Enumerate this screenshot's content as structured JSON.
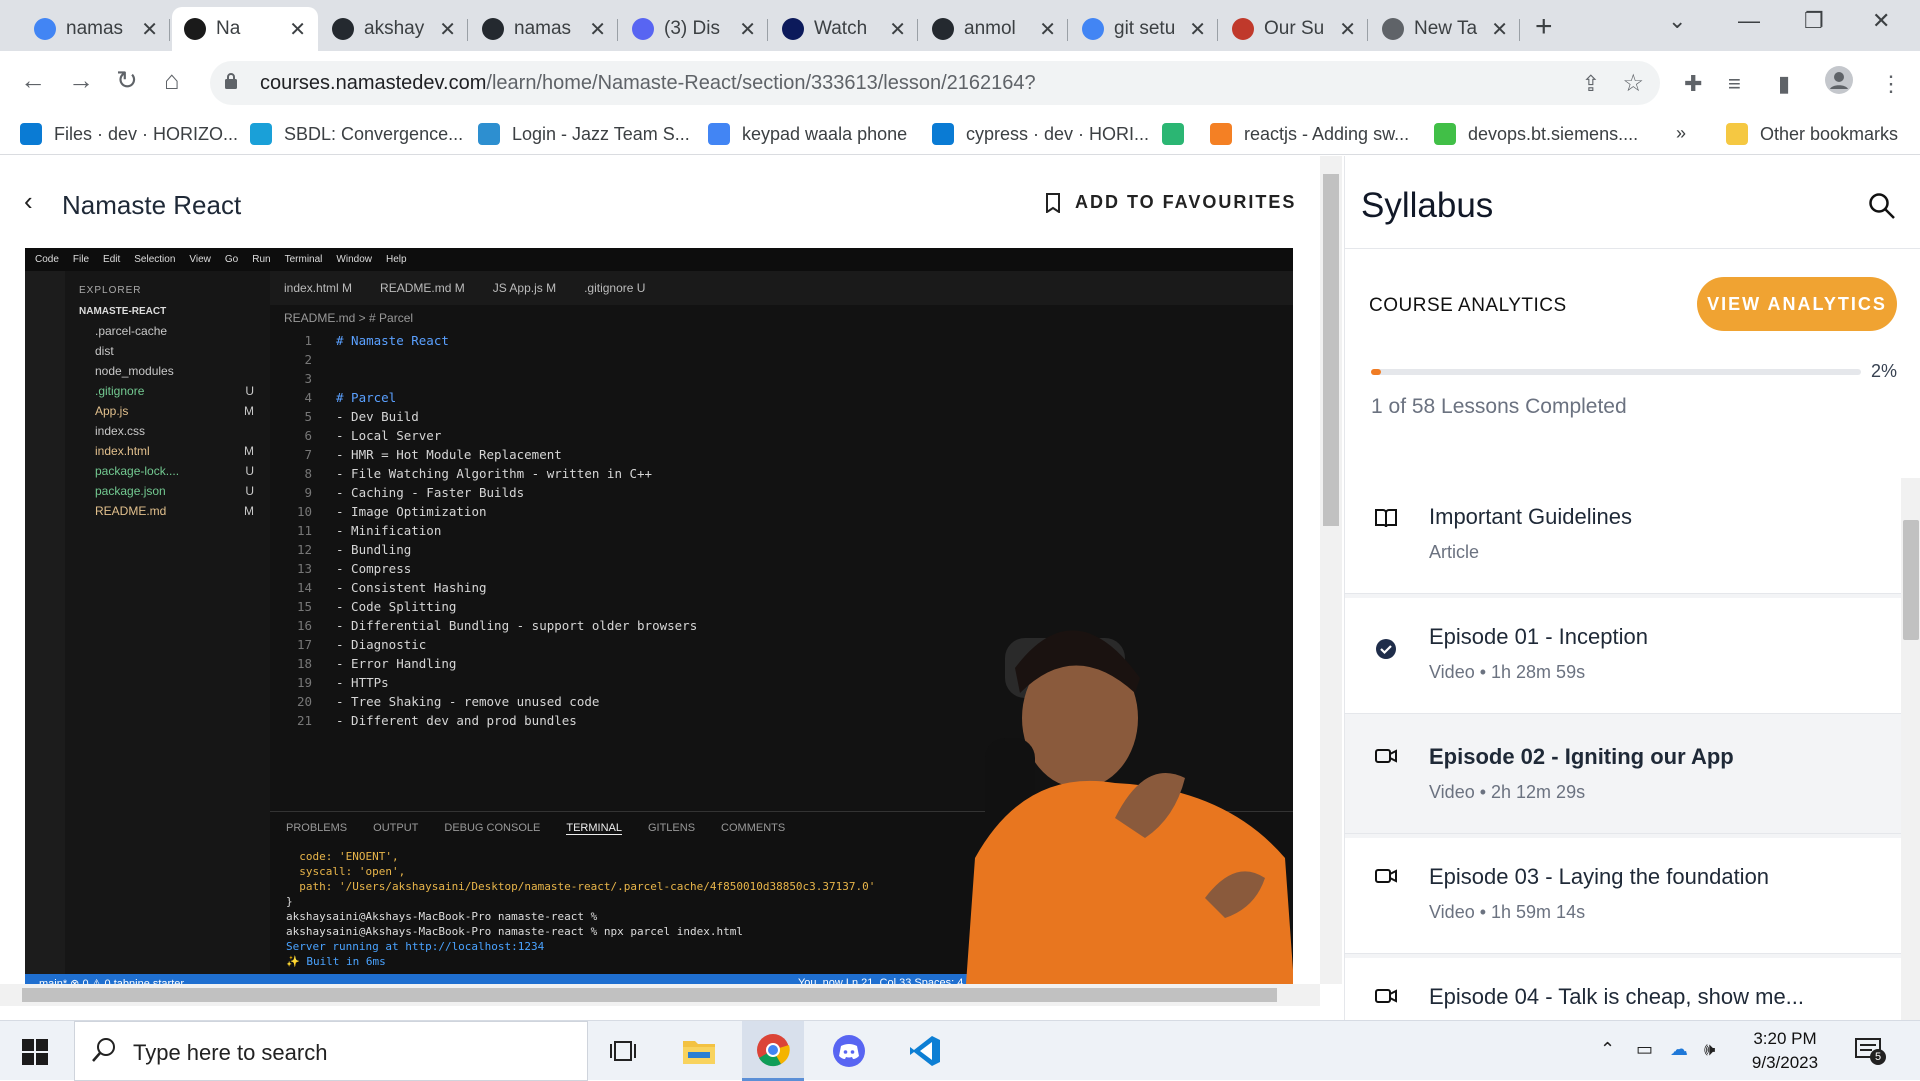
{
  "browser": {
    "tabs": [
      {
        "label": "namas",
        "icon": "google-icon",
        "color": "#4285f4"
      },
      {
        "label": "Na",
        "icon": "namaste-icon",
        "color": "#1a1a1a",
        "active": true
      },
      {
        "label": "akshay",
        "icon": "github-icon",
        "color": "#24292f"
      },
      {
        "label": "namas",
        "icon": "github-icon",
        "color": "#24292f"
      },
      {
        "label": "(3) Dis",
        "icon": "discord-icon",
        "color": "#5865f2"
      },
      {
        "label": "Watch",
        "icon": "hotstar-icon",
        "color": "#0c1a5b"
      },
      {
        "label": "anmol",
        "icon": "github-icon",
        "color": "#24292f"
      },
      {
        "label": "git setu",
        "icon": "google-icon",
        "color": "#4285f4"
      },
      {
        "label": "Our Su",
        "icon": "survey-icon",
        "color": "#c0392b"
      },
      {
        "label": "New Ta",
        "icon": "chrome-icon",
        "color": "#5f6368"
      }
    ],
    "url_host": "courses.namastedev.com",
    "url_path": "/learn/home/Namaste-React/section/333613/lesson/2162164?",
    "bookmarks": [
      {
        "label": "Files · dev · HORIZO...",
        "icon": "azure-icon",
        "color": "#0a7bd4"
      },
      {
        "label": "SBDL: Convergence...",
        "icon": "s-icon",
        "color": "#1aa0d8"
      },
      {
        "label": "Login - Jazz Team S...",
        "icon": "globe-icon",
        "color": "#2d8fd0"
      },
      {
        "label": "keypad waala phone",
        "icon": "google-icon",
        "color": "#4285f4"
      },
      {
        "label": "cypress · dev · HORI...",
        "icon": "azure-icon",
        "color": "#0a7bd4"
      },
      {
        "label": "",
        "icon": "s-circle-icon",
        "color": "#2bb673"
      },
      {
        "label": "reactjs - Adding sw...",
        "icon": "stackoverflow-icon",
        "color": "#f48024"
      },
      {
        "label": "devops.bt.siemens....",
        "icon": "jfrog-icon",
        "color": "#41bf47"
      },
      {
        "label": "Other bookmarks",
        "icon": "folder-icon",
        "color": "#f5c842"
      }
    ]
  },
  "page": {
    "course_title": "Namaste React",
    "favourites_label": "ADD TO FAVOURITES"
  },
  "video": {
    "menu": [
      "Code",
      "File",
      "Edit",
      "Selection",
      "View",
      "Go",
      "Run",
      "Terminal",
      "Window",
      "Help"
    ],
    "explorer_header": "EXPLORER",
    "project": "NAMASTE-REACT",
    "files": [
      {
        "name": ".parcel-cache",
        "status": ""
      },
      {
        "name": "dist",
        "status": ""
      },
      {
        "name": "node_modules",
        "status": ""
      },
      {
        "name": ".gitignore",
        "status": "U"
      },
      {
        "name": "App.js",
        "status": "M"
      },
      {
        "name": "index.css",
        "status": ""
      },
      {
        "name": "index.html",
        "status": "M"
      },
      {
        "name": "package-lock....",
        "status": "U"
      },
      {
        "name": "package.json",
        "status": "U"
      },
      {
        "name": "README.md",
        "status": "M"
      }
    ],
    "editor_tabs": [
      "index.html M",
      "README.md M",
      "JS App.js M",
      ".gitignore U"
    ],
    "breadcrumb": "README.md > # Parcel",
    "code_lines": [
      "# Namaste React",
      "",
      "",
      "# Parcel",
      "- Dev Build",
      "- Local Server",
      "- HMR = Hot Module Replacement",
      "- File Watching Algorithm - written in C++",
      "- Caching - Faster Builds",
      "- Image Optimization",
      "- Minification",
      "- Bundling",
      "- Compress",
      "- Consistent Hashing",
      "- Code Splitting",
      "- Differential Bundling - support older browsers",
      "- Diagnostic",
      "- Error Handling",
      "- HTTPs",
      "- Tree Shaking - remove unused code",
      "- Different dev and prod bundles"
    ],
    "terminal_tabs": [
      "PROBLEMS",
      "OUTPUT",
      "DEBUG CONSOLE",
      "TERMINAL",
      "GITLENS",
      "COMMENTS"
    ],
    "terminal_lines": [
      "  code: 'ENOENT',",
      "  syscall: 'open',",
      "  path: '/Users/akshaysaini/Desktop/namaste-react/.parcel-cache/4f850010d38850c3.37137.0'",
      "}",
      "akshaysaini@Akshays-MacBook-Pro namaste-react %",
      "akshaysaini@Akshays-MacBook-Pro namaste-react % npx parcel index.html",
      "Server running at http://localhost:1234",
      "✨ Built in 6ms"
    ],
    "status_left": "main*   ⊗ 0 ⚠ 0   tabnine starter",
    "status_right": "You, now   Ln 21, Col 33   Spaces: 4   LF   Markdown"
  },
  "syllabus": {
    "title": "Syllabus",
    "analytics_label": "COURSE ANALYTICS",
    "view_analytics": "VIEW ANALYTICS",
    "progress_pct": "2%",
    "progress_value": 0.02,
    "lessons_completed": "1 of 58 Lessons Completed",
    "lessons": [
      {
        "title": "Important Guidelines",
        "meta": "Article",
        "icon": "book-icon"
      },
      {
        "title": "Episode 01 - Inception",
        "meta": "Video • 1h 28m 59s",
        "icon": "check-circle-icon"
      },
      {
        "title": "Episode 02 - Igniting our App",
        "meta": "Video • 2h 12m 29s",
        "icon": "video-icon",
        "current": true
      },
      {
        "title": "Episode 03 - Laying the foundation",
        "meta": "Video • 1h 59m 14s",
        "icon": "video-icon"
      },
      {
        "title": "Episode 04 - Talk is cheap, show me...",
        "meta": "",
        "icon": "video-icon"
      }
    ]
  },
  "taskbar": {
    "search_placeholder": "Type here to search",
    "time": "3:20 PM",
    "date": "9/3/2023",
    "notifications": "5"
  }
}
